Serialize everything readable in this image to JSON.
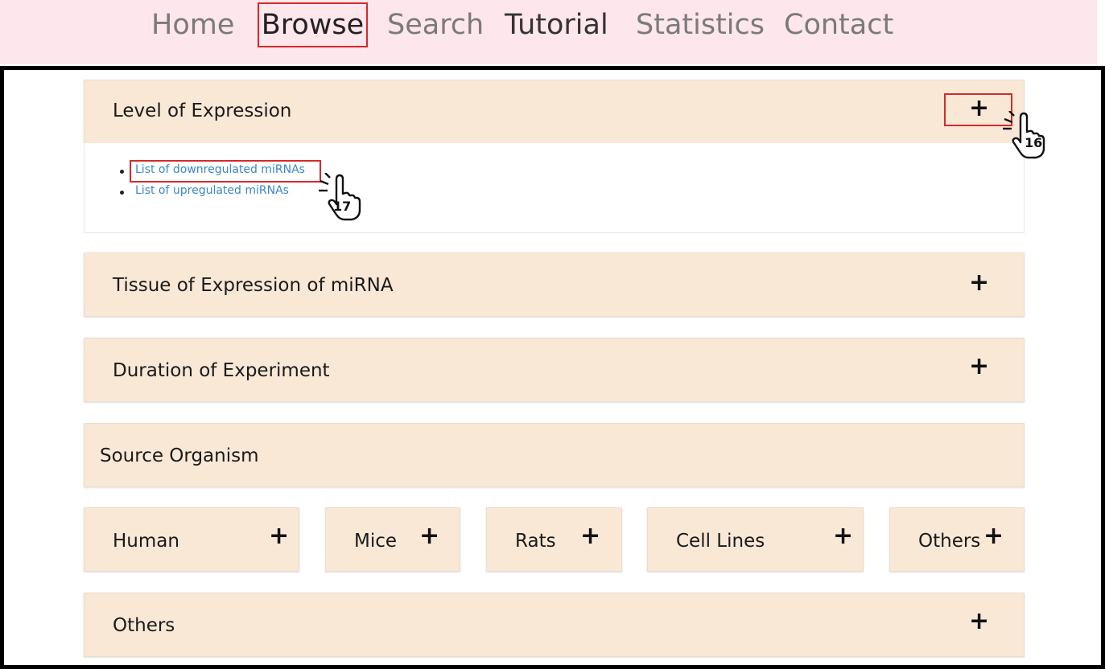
{
  "nav": {
    "home": "Home",
    "browse": "Browse",
    "search": "Search",
    "tutorial": "Tutorial",
    "statistics": "Statistics",
    "contact": "Contact"
  },
  "panels": {
    "level_of_expression": "Level of Expression",
    "tissue_of_expression": "Tissue of Expression of miRNA",
    "duration_of_experiment": "Duration of Experiment",
    "source_organism": "Source Organism",
    "others": "Others"
  },
  "organisms": {
    "human": "Human",
    "mice": "Mice",
    "rats": "Rats",
    "cell_lines": "Cell Lines",
    "others": "Others"
  },
  "links": {
    "downregulated": "List of downregulated miRNAs",
    "upregulated": "List of upregulated miRNAs"
  },
  "icons": {
    "plus": "+",
    "hand": "pointing-hand-icon"
  },
  "steps": {
    "step16": "16",
    "step17": "17"
  },
  "colors": {
    "panel_bg": "#f9e8d6",
    "nav_bg": "#fde6ec",
    "link": "#3a87c8",
    "highlight": "#d42a2a"
  }
}
